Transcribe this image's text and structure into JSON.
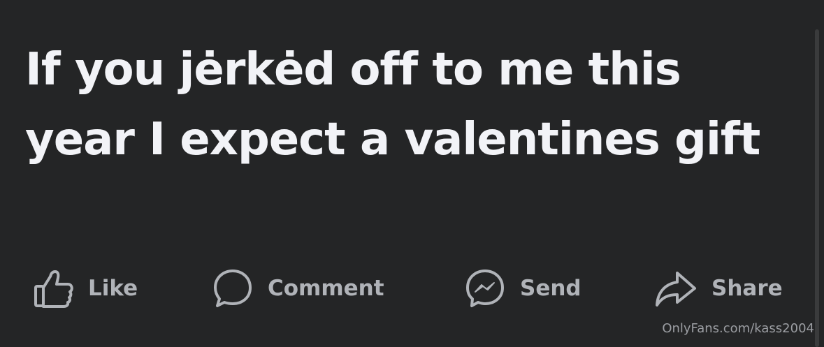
{
  "post": {
    "text": "If you jėrkėd off to me this year I expect a valentines gift"
  },
  "actions": [
    {
      "label": "Like",
      "icon": "thumbs-up-icon"
    },
    {
      "label": "Comment",
      "icon": "comment-bubble-icon"
    },
    {
      "label": "Send",
      "icon": "messenger-icon"
    },
    {
      "label": "Share",
      "icon": "share-arrow-icon"
    }
  ],
  "watermark": "OnlyFans.com/kass2004",
  "colors": {
    "background": "#242526",
    "post_text": "#f2f3f7",
    "action_text": "#b0b3b8"
  }
}
